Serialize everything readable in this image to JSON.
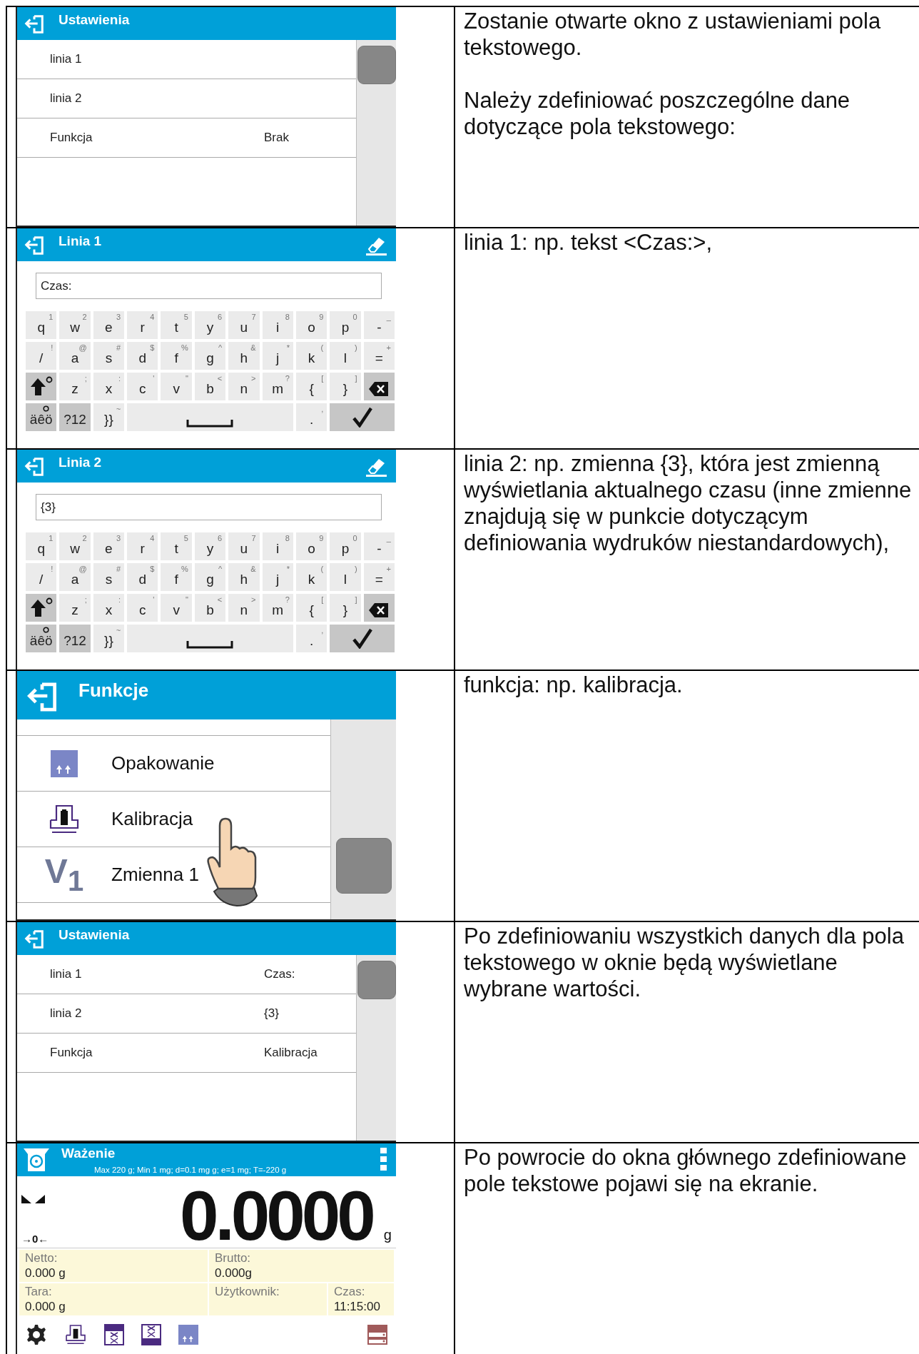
{
  "rows": [
    {
      "screen": {
        "kind": "settings",
        "title": "Ustawienia",
        "items": [
          {
            "label": "linia 1"
          },
          {
            "label": "linia 2"
          },
          {
            "label": "Funkcja",
            "value": "Brak"
          }
        ]
      },
      "description": [
        "Zostanie otwarte okno z ustawieniami pola tekstowego.",
        "Należy zdefiniować poszczególne dane dotyczące pola tekstowego:"
      ]
    },
    {
      "screen": {
        "kind": "keyboard",
        "title": "Linia 1",
        "value": "Czas:",
        "keys": [
          [
            {
              "kind": "char",
              "label": "q",
              "alt": "1"
            },
            {
              "kind": "char",
              "label": "w",
              "alt": "2"
            },
            {
              "kind": "char",
              "label": "e",
              "alt": "3"
            },
            {
              "kind": "char",
              "label": "r",
              "alt": "4"
            },
            {
              "kind": "char",
              "label": "t",
              "alt": "5"
            },
            {
              "kind": "char",
              "label": "y",
              "alt": "6"
            },
            {
              "kind": "char",
              "label": "u",
              "alt": "7"
            },
            {
              "kind": "char",
              "label": "i",
              "alt": "8"
            },
            {
              "kind": "char",
              "label": "o",
              "alt": "9"
            },
            {
              "kind": "char",
              "label": "p",
              "alt": "0"
            },
            {
              "kind": "char",
              "label": "-",
              "alt": "_"
            }
          ],
          [
            {
              "kind": "char",
              "label": "/",
              "alt": "!"
            },
            {
              "kind": "char",
              "label": "a",
              "alt": "@"
            },
            {
              "kind": "char",
              "label": "s",
              "alt": "#"
            },
            {
              "kind": "char",
              "label": "d",
              "alt": "$"
            },
            {
              "kind": "char",
              "label": "f",
              "alt": "%"
            },
            {
              "kind": "char",
              "label": "g",
              "alt": "^"
            },
            {
              "kind": "char",
              "label": "h",
              "alt": "&"
            },
            {
              "kind": "char",
              "label": "j",
              "alt": "*"
            },
            {
              "kind": "char",
              "label": "k",
              "alt": "("
            },
            {
              "kind": "char",
              "label": "l",
              "alt": ")"
            },
            {
              "kind": "char",
              "label": "=",
              "alt": "+"
            }
          ],
          [
            {
              "kind": "shift"
            },
            {
              "kind": "char",
              "label": "z",
              "alt": ";"
            },
            {
              "kind": "char",
              "label": "x",
              "alt": ":"
            },
            {
              "kind": "char",
              "label": "c",
              "alt": "'"
            },
            {
              "kind": "char",
              "label": "v",
              "alt": "\""
            },
            {
              "kind": "char",
              "label": "b",
              "alt": "<"
            },
            {
              "kind": "char",
              "label": "n",
              "alt": ">"
            },
            {
              "kind": "char",
              "label": "m",
              "alt": "?"
            },
            {
              "kind": "char",
              "label": "{",
              "alt": "["
            },
            {
              "kind": "char",
              "label": "}",
              "alt": "]"
            },
            {
              "kind": "backspace"
            }
          ],
          [
            {
              "kind": "mode",
              "label": "äêö",
              "marker": true
            },
            {
              "kind": "mode",
              "label": "?12"
            },
            {
              "kind": "char",
              "label": "}}",
              "alt": "~"
            },
            {
              "kind": "space"
            },
            {
              "kind": "char",
              "label": ".",
              "alt": ","
            },
            {
              "kind": "enter"
            }
          ]
        ]
      },
      "description": [
        "linia 1: np. tekst <Czas:>,"
      ]
    },
    {
      "screen": {
        "kind": "keyboard",
        "title": "Linia 2",
        "value": "{3}",
        "keys": [
          [
            {
              "kind": "char",
              "label": "q",
              "alt": "1"
            },
            {
              "kind": "char",
              "label": "w",
              "alt": "2"
            },
            {
              "kind": "char",
              "label": "e",
              "alt": "3"
            },
            {
              "kind": "char",
              "label": "r",
              "alt": "4"
            },
            {
              "kind": "char",
              "label": "t",
              "alt": "5"
            },
            {
              "kind": "char",
              "label": "y",
              "alt": "6"
            },
            {
              "kind": "char",
              "label": "u",
              "alt": "7"
            },
            {
              "kind": "char",
              "label": "i",
              "alt": "8"
            },
            {
              "kind": "char",
              "label": "o",
              "alt": "9"
            },
            {
              "kind": "char",
              "label": "p",
              "alt": "0"
            },
            {
              "kind": "char",
              "label": "-",
              "alt": "_"
            }
          ],
          [
            {
              "kind": "char",
              "label": "/",
              "alt": "!"
            },
            {
              "kind": "char",
              "label": "a",
              "alt": "@"
            },
            {
              "kind": "char",
              "label": "s",
              "alt": "#"
            },
            {
              "kind": "char",
              "label": "d",
              "alt": "$"
            },
            {
              "kind": "char",
              "label": "f",
              "alt": "%"
            },
            {
              "kind": "char",
              "label": "g",
              "alt": "^"
            },
            {
              "kind": "char",
              "label": "h",
              "alt": "&"
            },
            {
              "kind": "char",
              "label": "j",
              "alt": "*"
            },
            {
              "kind": "char",
              "label": "k",
              "alt": "("
            },
            {
              "kind": "char",
              "label": "l",
              "alt": ")"
            },
            {
              "kind": "char",
              "label": "=",
              "alt": "+"
            }
          ],
          [
            {
              "kind": "shift"
            },
            {
              "kind": "char",
              "label": "z",
              "alt": ";"
            },
            {
              "kind": "char",
              "label": "x",
              "alt": ":"
            },
            {
              "kind": "char",
              "label": "c",
              "alt": "'"
            },
            {
              "kind": "char",
              "label": "v",
              "alt": "\""
            },
            {
              "kind": "char",
              "label": "b",
              "alt": "<"
            },
            {
              "kind": "char",
              "label": "n",
              "alt": ">"
            },
            {
              "kind": "char",
              "label": "m",
              "alt": "?"
            },
            {
              "kind": "char",
              "label": "{",
              "alt": "["
            },
            {
              "kind": "char",
              "label": "}",
              "alt": "]"
            },
            {
              "kind": "backspace"
            }
          ],
          [
            {
              "kind": "mode",
              "label": "äêö",
              "marker": true
            },
            {
              "kind": "mode",
              "label": "?12"
            },
            {
              "kind": "char",
              "label": "}}",
              "alt": "~"
            },
            {
              "kind": "space"
            },
            {
              "kind": "char",
              "label": ".",
              "alt": ","
            },
            {
              "kind": "enter"
            }
          ]
        ]
      },
      "description": [
        "linia 2: np. zmienna {3}, która jest zmienną wyświetlania aktualnego czasu (inne zmienne znajdują się w punkcie dotyczącym definiowania wydruków niestandardowych),"
      ]
    },
    {
      "screen": {
        "kind": "functions",
        "title": "Funkcje",
        "items": [
          {
            "kind": "tare",
            "label": "Opakowanie"
          },
          {
            "kind": "calibration",
            "label": "Kalibracja"
          },
          {
            "kind": "variable",
            "icon_text": "V$_{1}$",
            "label": "Zmienna 1"
          }
        ]
      },
      "description": [
        "funkcja: np. kalibracja."
      ]
    },
    {
      "screen": {
        "kind": "settings",
        "title": "Ustawienia",
        "items": [
          {
            "label": "linia 1",
            "value": "Czas:"
          },
          {
            "label": "linia 2",
            "value": "{3}"
          },
          {
            "label": "Funkcja",
            "value": "Kalibracja"
          }
        ]
      },
      "description": [
        "Po zdefiniowaniu wszystkich danych dla pola tekstowego w oknie będą wyświetlane wybrane wartości."
      ]
    },
    {
      "screen": {
        "kind": "weighing",
        "title": "Ważenie",
        "subtitle": "Max 220 g; Min 1 mg; d=0.1 mg g; e=1 mg; T=-220 g",
        "zero": "→0←",
        "reading": "0.0000",
        "unit": "g",
        "info": [
          {
            "label": "Netto:",
            "value": "0.000 g"
          },
          {
            "label": "Brutto:",
            "value": "0.000g"
          },
          {
            "label": "Tara:",
            "value": "0.000 g"
          },
          {
            "label": "Użytkownik:"
          },
          {
            "label": "Czas:",
            "value": "11:15:00"
          }
        ],
        "toolbar": [
          {
            "kind": "settings"
          },
          {
            "kind": "calibration"
          },
          {
            "kind": "table-top"
          },
          {
            "kind": "table-bottom"
          },
          {
            "kind": "tare"
          },
          {
            "kind": "database"
          }
        ]
      },
      "description": [
        "Po powrocie do okna głównego zdefiniowane pole tekstowe pojawi się na ekranie."
      ]
    }
  ]
}
